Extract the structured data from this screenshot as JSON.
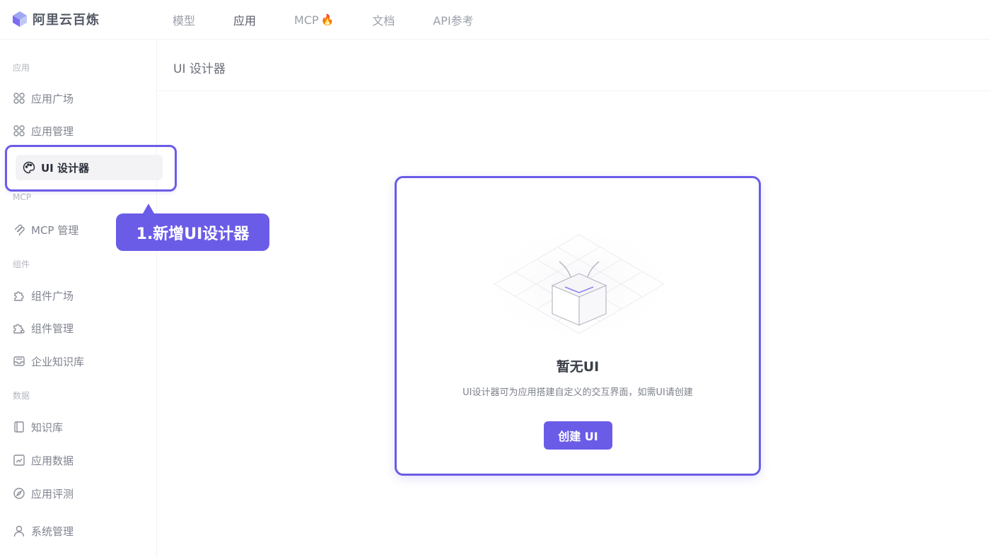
{
  "brand": {
    "name": "阿里云百炼"
  },
  "nav": {
    "items": [
      {
        "label": "模型",
        "active": false
      },
      {
        "label": "应用",
        "active": true
      },
      {
        "label": "MCP",
        "active": false,
        "icon": "fire-icon"
      },
      {
        "label": "文档",
        "active": false
      },
      {
        "label": "API参考",
        "active": false
      }
    ]
  },
  "sidebar": {
    "sections": {
      "app": "应用",
      "mcp": "MCP",
      "component": "组件",
      "data": "数据"
    },
    "items": {
      "app_plaza": "应用广场",
      "app_manage": "应用管理",
      "ui_designer": "UI 设计器",
      "mcp_manage": "MCP 管理",
      "comp_plaza": "组件广场",
      "comp_manage": "组件管理",
      "enterprise_kb": "企业知识库",
      "kb": "知识库",
      "app_data": "应用数据",
      "app_eval": "应用评测",
      "sys_manage": "系统管理"
    }
  },
  "annotation": {
    "callout": "1.新增UI设计器"
  },
  "main": {
    "title": "UI 设计器",
    "empty": {
      "title": "暂无UI",
      "desc": "UI设计器可为应用搭建自定义的交互界面，如需UI请创建",
      "button": "创建 UI"
    }
  },
  "colors": {
    "accent": "#6b5ce7",
    "text_muted": "#80848f"
  }
}
